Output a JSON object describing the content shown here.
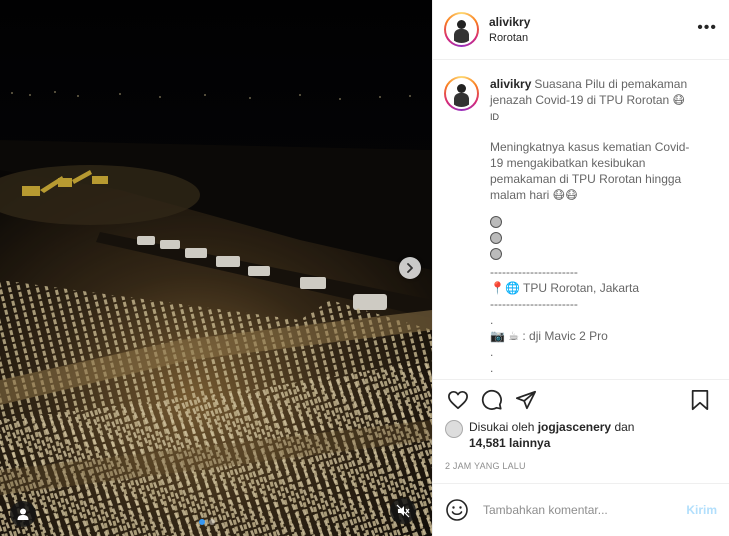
{
  "post": {
    "username": "alivikry",
    "location": "Rorotan",
    "more_label": "•••"
  },
  "caption": {
    "username": "alivikry",
    "title_lines": [
      "Suasana Pilu di pemakaman",
      "jenazah Covid-19 di TPU Rorotan 😷"
    ],
    "lang": "ID",
    "body_lines": [
      "Meningkatnya kasus kematian Covid-",
      "19 mengakibatkan kesibukan",
      "pemakaman di TPU Rorotan hingga",
      "malam hari 😷😷"
    ],
    "divider_1": "----------------------",
    "location_line": "TPU Rorotan, Jakarta",
    "location_icons": "📍🌐",
    "divider_2": "----------------------",
    "dot_1": ".",
    "gear_icons": "📷 ☕",
    "gear_line": ": dji Mavic 2 Pro",
    "dot_2": ".",
    "dot_3": "."
  },
  "likes": {
    "prefix": "Disukai oleh",
    "user": "jogjascenery",
    "connector": "dan",
    "count": "14,581 lainnya"
  },
  "timestamp": "2 JAM YANG LALU",
  "comment": {
    "placeholder": "Tambahkan komentar...",
    "post_label": "Kirim"
  },
  "carousel": {
    "slides": 2,
    "active": 1
  },
  "colors": {
    "accent": "#3897f0",
    "post_button": "#b2dffc",
    "muted": "#8e8e8e"
  },
  "icons": [
    "next-arrow-icon",
    "user-tag-icon",
    "muted-speaker-icon",
    "heart-icon",
    "comment-icon",
    "share-icon",
    "bookmark-icon",
    "emoji-icon",
    "more-icon"
  ]
}
